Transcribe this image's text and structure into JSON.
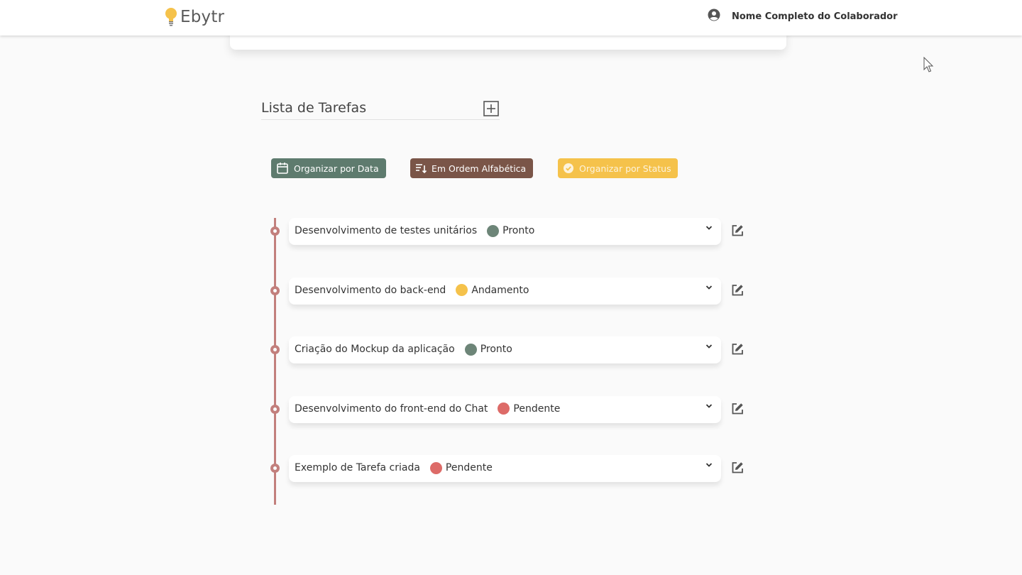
{
  "header": {
    "logo_text": "Ebytr",
    "user_name": "Nome Completo do Colaborador"
  },
  "tasks_section": {
    "title": "Lista de Tarefas"
  },
  "sort_buttons": {
    "date": "Organizar por Data",
    "alpha": "Em Ordem Alfabética",
    "status": "Organizar por Status"
  },
  "colors": {
    "accent": "#c27f7c",
    "pronto": "#6d8578",
    "andamento": "#f5c24b",
    "pendente": "#dd6b68"
  },
  "tasks": [
    {
      "title": "Desenvolvimento de testes unitários",
      "status": "Pronto",
      "status_color": "#6d8578"
    },
    {
      "title": "Desenvolvimento do back-end",
      "status": "Andamento",
      "status_color": "#f5c24b"
    },
    {
      "title": "Criação do Mockup da aplicação",
      "status": "Pronto",
      "status_color": "#6d8578"
    },
    {
      "title": "Desenvolvimento do front-end do Chat",
      "status": "Pendente",
      "status_color": "#dd6b68"
    },
    {
      "title": "Exemplo de Tarefa criada",
      "status": "Pendente",
      "status_color": "#dd6b68"
    }
  ]
}
